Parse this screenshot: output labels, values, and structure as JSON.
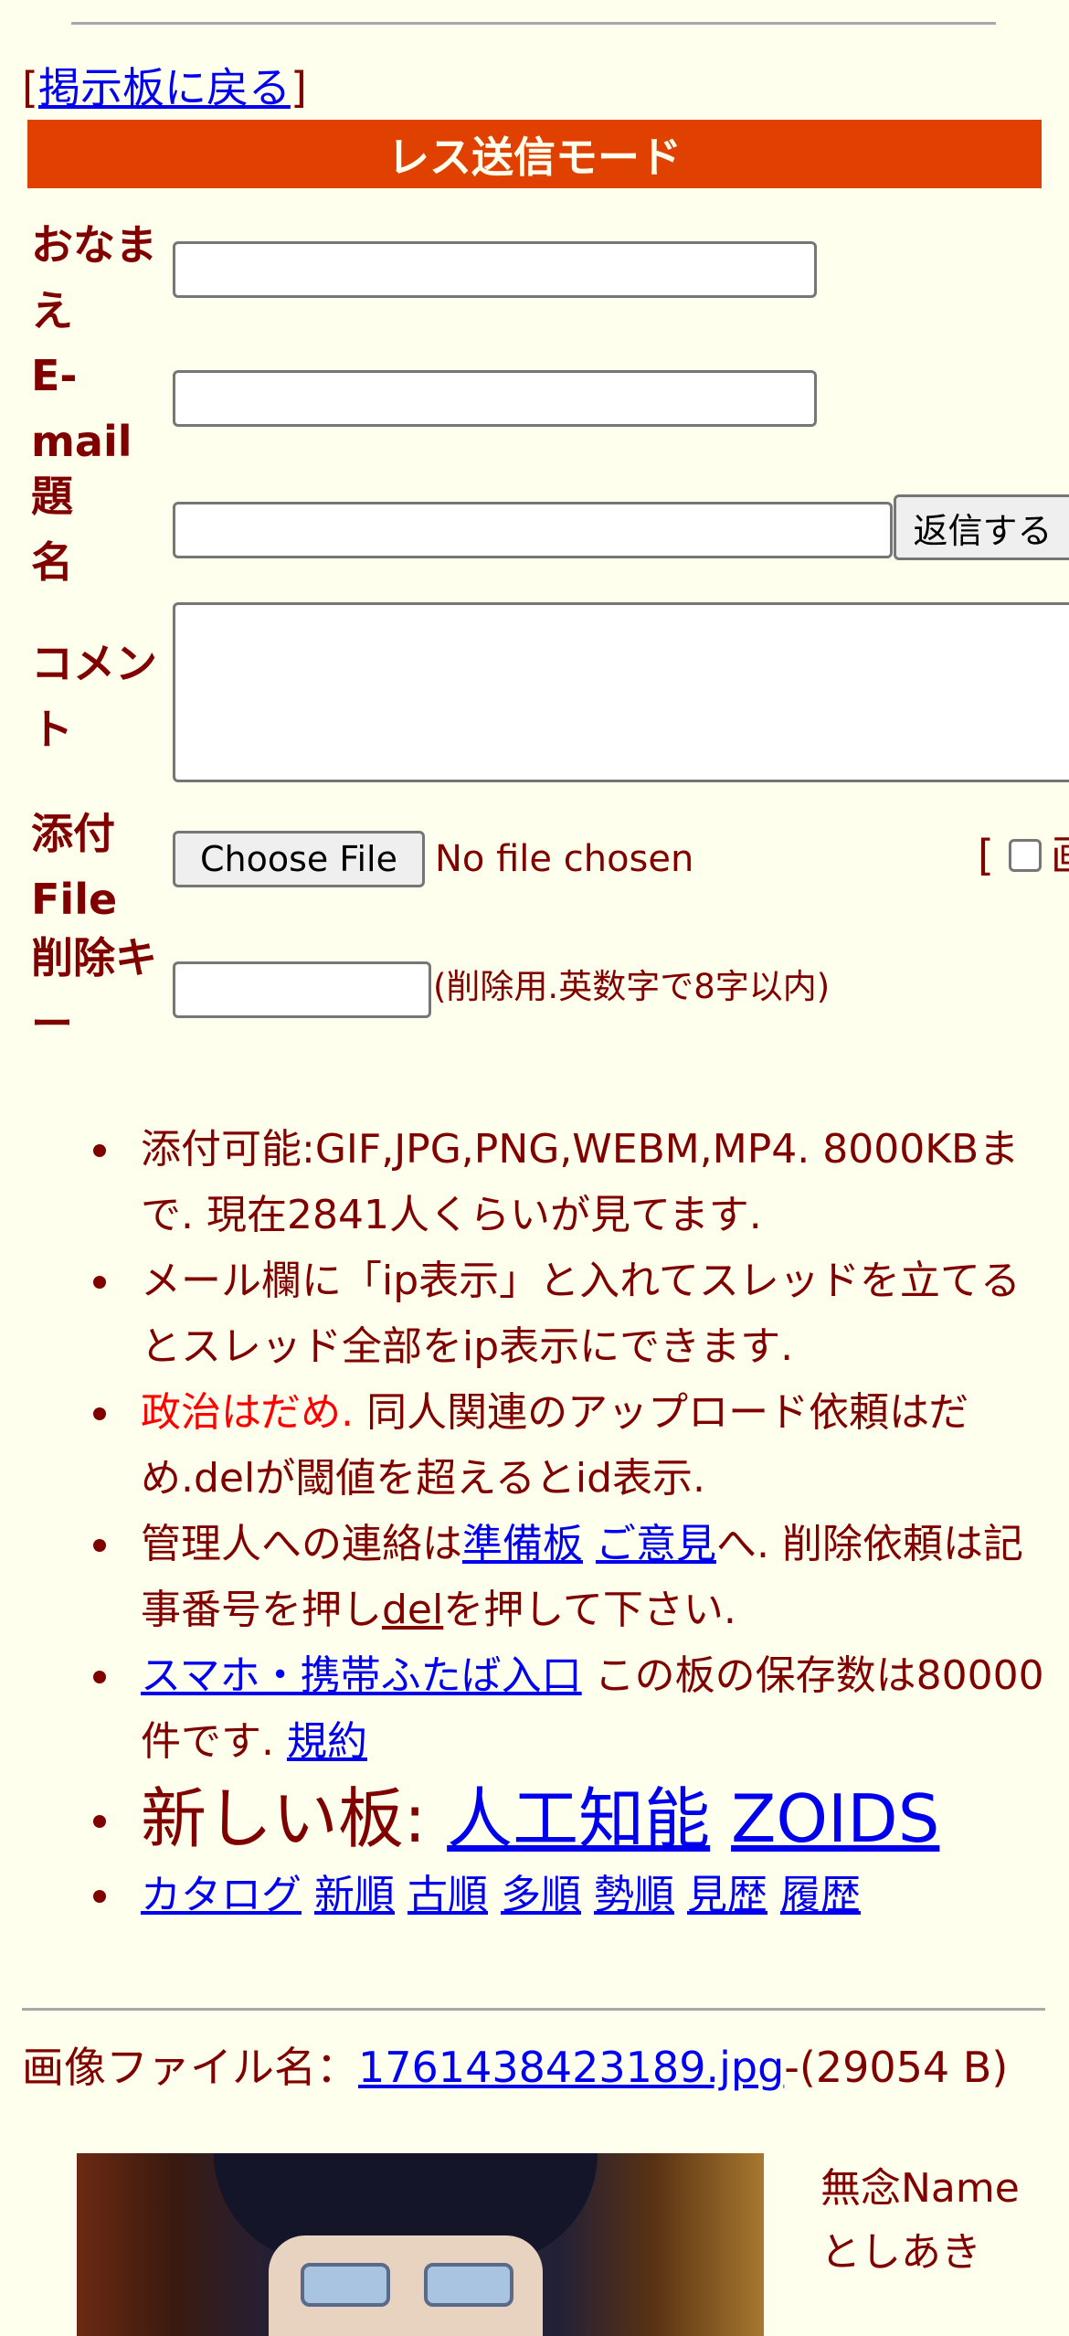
{
  "back_link": {
    "open": "[",
    "label": "掲示板に戻る",
    "close": "]"
  },
  "mode_title": "レス送信モード",
  "form": {
    "name_label_1": "おなま",
    "name_label_2": "え",
    "email_label_1": "E-",
    "email_label_2": "mail",
    "subject_label_1": "題",
    "subject_label_2": "名",
    "submit_label": "返信する",
    "comment_label_1": "コメン",
    "comment_label_2": "ト",
    "file_label_1": "添付",
    "file_label_2": "File",
    "choose_file": "Choose File",
    "no_file": "No file chosen",
    "image_bracket": "[",
    "image_checkbox_label": "画",
    "delkey_label_1": "削除キ",
    "delkey_label_2": "ー",
    "delkey_hint": "(削除用.英数字で8字以内)"
  },
  "notes": {
    "n1": "添付可能:GIF,JPG,PNG,WEBM,MP4. 8000KBまで. 現在2841人くらいが見てます.",
    "n2": "メール欄に「ip表示」と入れてスレッドを立てるとスレッド全部をip表示にできます.",
    "n3_red": "政治はだめ.",
    "n3_rest": " 同人関連のアップロード依頼はだめ.delが閾値を超えるとid表示.",
    "n4_a": "管理人への連絡は",
    "n4_link1": "準備板",
    "n4_link2": "ご意見",
    "n4_b": "へ. 削除依頼は記事番号を押し",
    "n4_link3": "del",
    "n4_c": "を押して下さい.",
    "n5_link": "スマホ・携帯ふたば入口",
    "n5_text": " この板の保存数は80000件です. ",
    "n5_link2": "規約",
    "n6_text": "新しい板: ",
    "n6_link1": "人工知能",
    "n6_link2": "ZOIDS",
    "nav": [
      "カタログ",
      "新順",
      "古順",
      "多順",
      "勢順",
      "見歴",
      "履歴"
    ]
  },
  "post": {
    "file_prefix": "画像ファイル名：",
    "file_name": "1761438423189.jpg",
    "file_size": "-(29054 B)",
    "author_1": "無念Name",
    "author_2": "としあき"
  }
}
